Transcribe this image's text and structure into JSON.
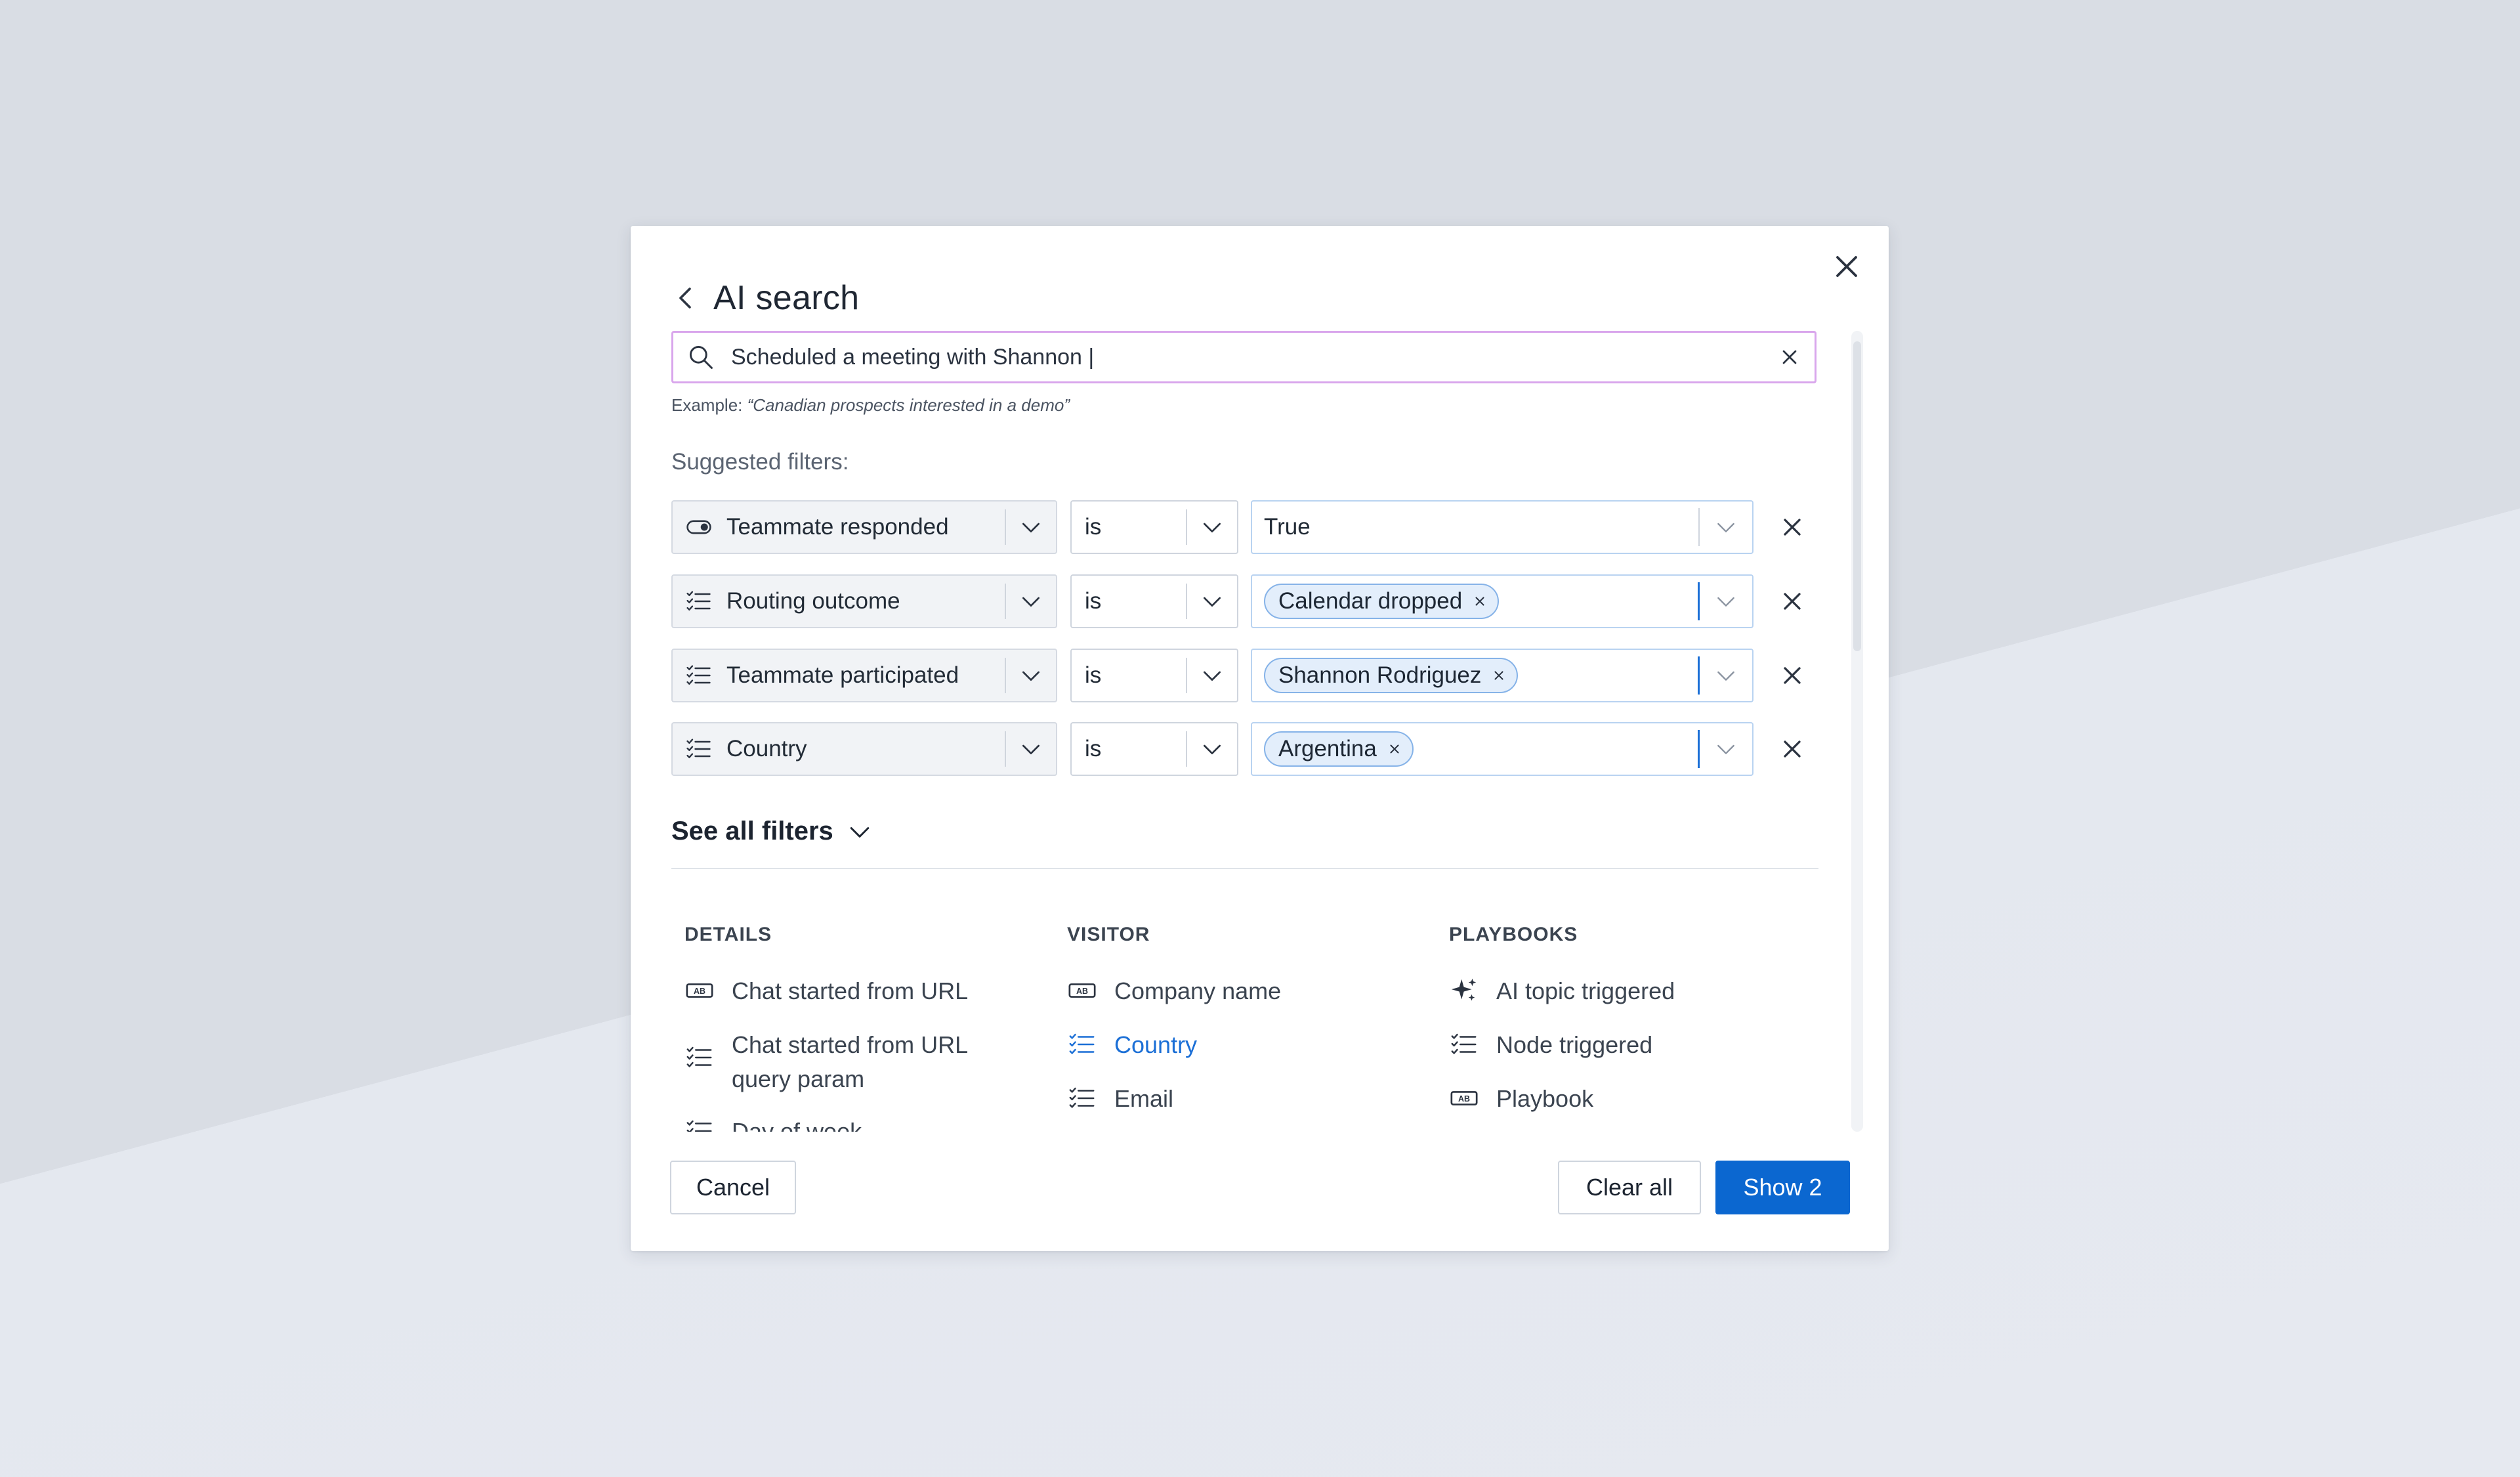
{
  "dialog": {
    "title": "AI search",
    "search_value": "Scheduled a meeting with Shannon |",
    "example_prefix": "Example: ",
    "example_text": "“Canadian prospects interested in a demo”",
    "suggested_label": "Suggested filters:"
  },
  "filters": [
    {
      "field": "Teammate responded",
      "icon": "toggle-icon",
      "operator": "is",
      "value": "True",
      "value_type": "text"
    },
    {
      "field": "Routing outcome",
      "icon": "checklist-icon",
      "operator": "is",
      "value": "Calendar dropped",
      "value_type": "chip"
    },
    {
      "field": "Teammate participated",
      "icon": "checklist-icon",
      "operator": "is",
      "value": "Shannon Rodriguez",
      "value_type": "chip"
    },
    {
      "field": "Country",
      "icon": "checklist-icon",
      "operator": "is",
      "value": "Argentina",
      "value_type": "chip"
    }
  ],
  "see_all": {
    "label": "See all filters"
  },
  "columns": [
    {
      "heading": "DETAILS",
      "items": [
        {
          "label": "Chat started from URL",
          "icon": "text-field-icon"
        },
        {
          "label": "Chat started from URL query param",
          "icon": "checklist-icon"
        },
        {
          "label": "Day of week",
          "icon": "checklist-icon"
        }
      ]
    },
    {
      "heading": "VISITOR",
      "items": [
        {
          "label": "Company name",
          "icon": "text-field-icon"
        },
        {
          "label": "Country",
          "icon": "checklist-icon",
          "active": true
        },
        {
          "label": "Email",
          "icon": "checklist-icon"
        }
      ]
    },
    {
      "heading": "PLAYBOOKS",
      "items": [
        {
          "label": "AI topic triggered",
          "icon": "sparkle-icon"
        },
        {
          "label": "Node triggered",
          "icon": "checklist-icon"
        },
        {
          "label": "Playbook",
          "icon": "text-field-icon"
        }
      ]
    }
  ],
  "footer": {
    "cancel": "Cancel",
    "clear_all": "Clear all",
    "show": "Show 2"
  },
  "colors": {
    "primary": "#0b67d0",
    "search_border": "#d9a6ec",
    "chip_bg": "#e3eefb",
    "active_link": "#1b6fd6"
  }
}
